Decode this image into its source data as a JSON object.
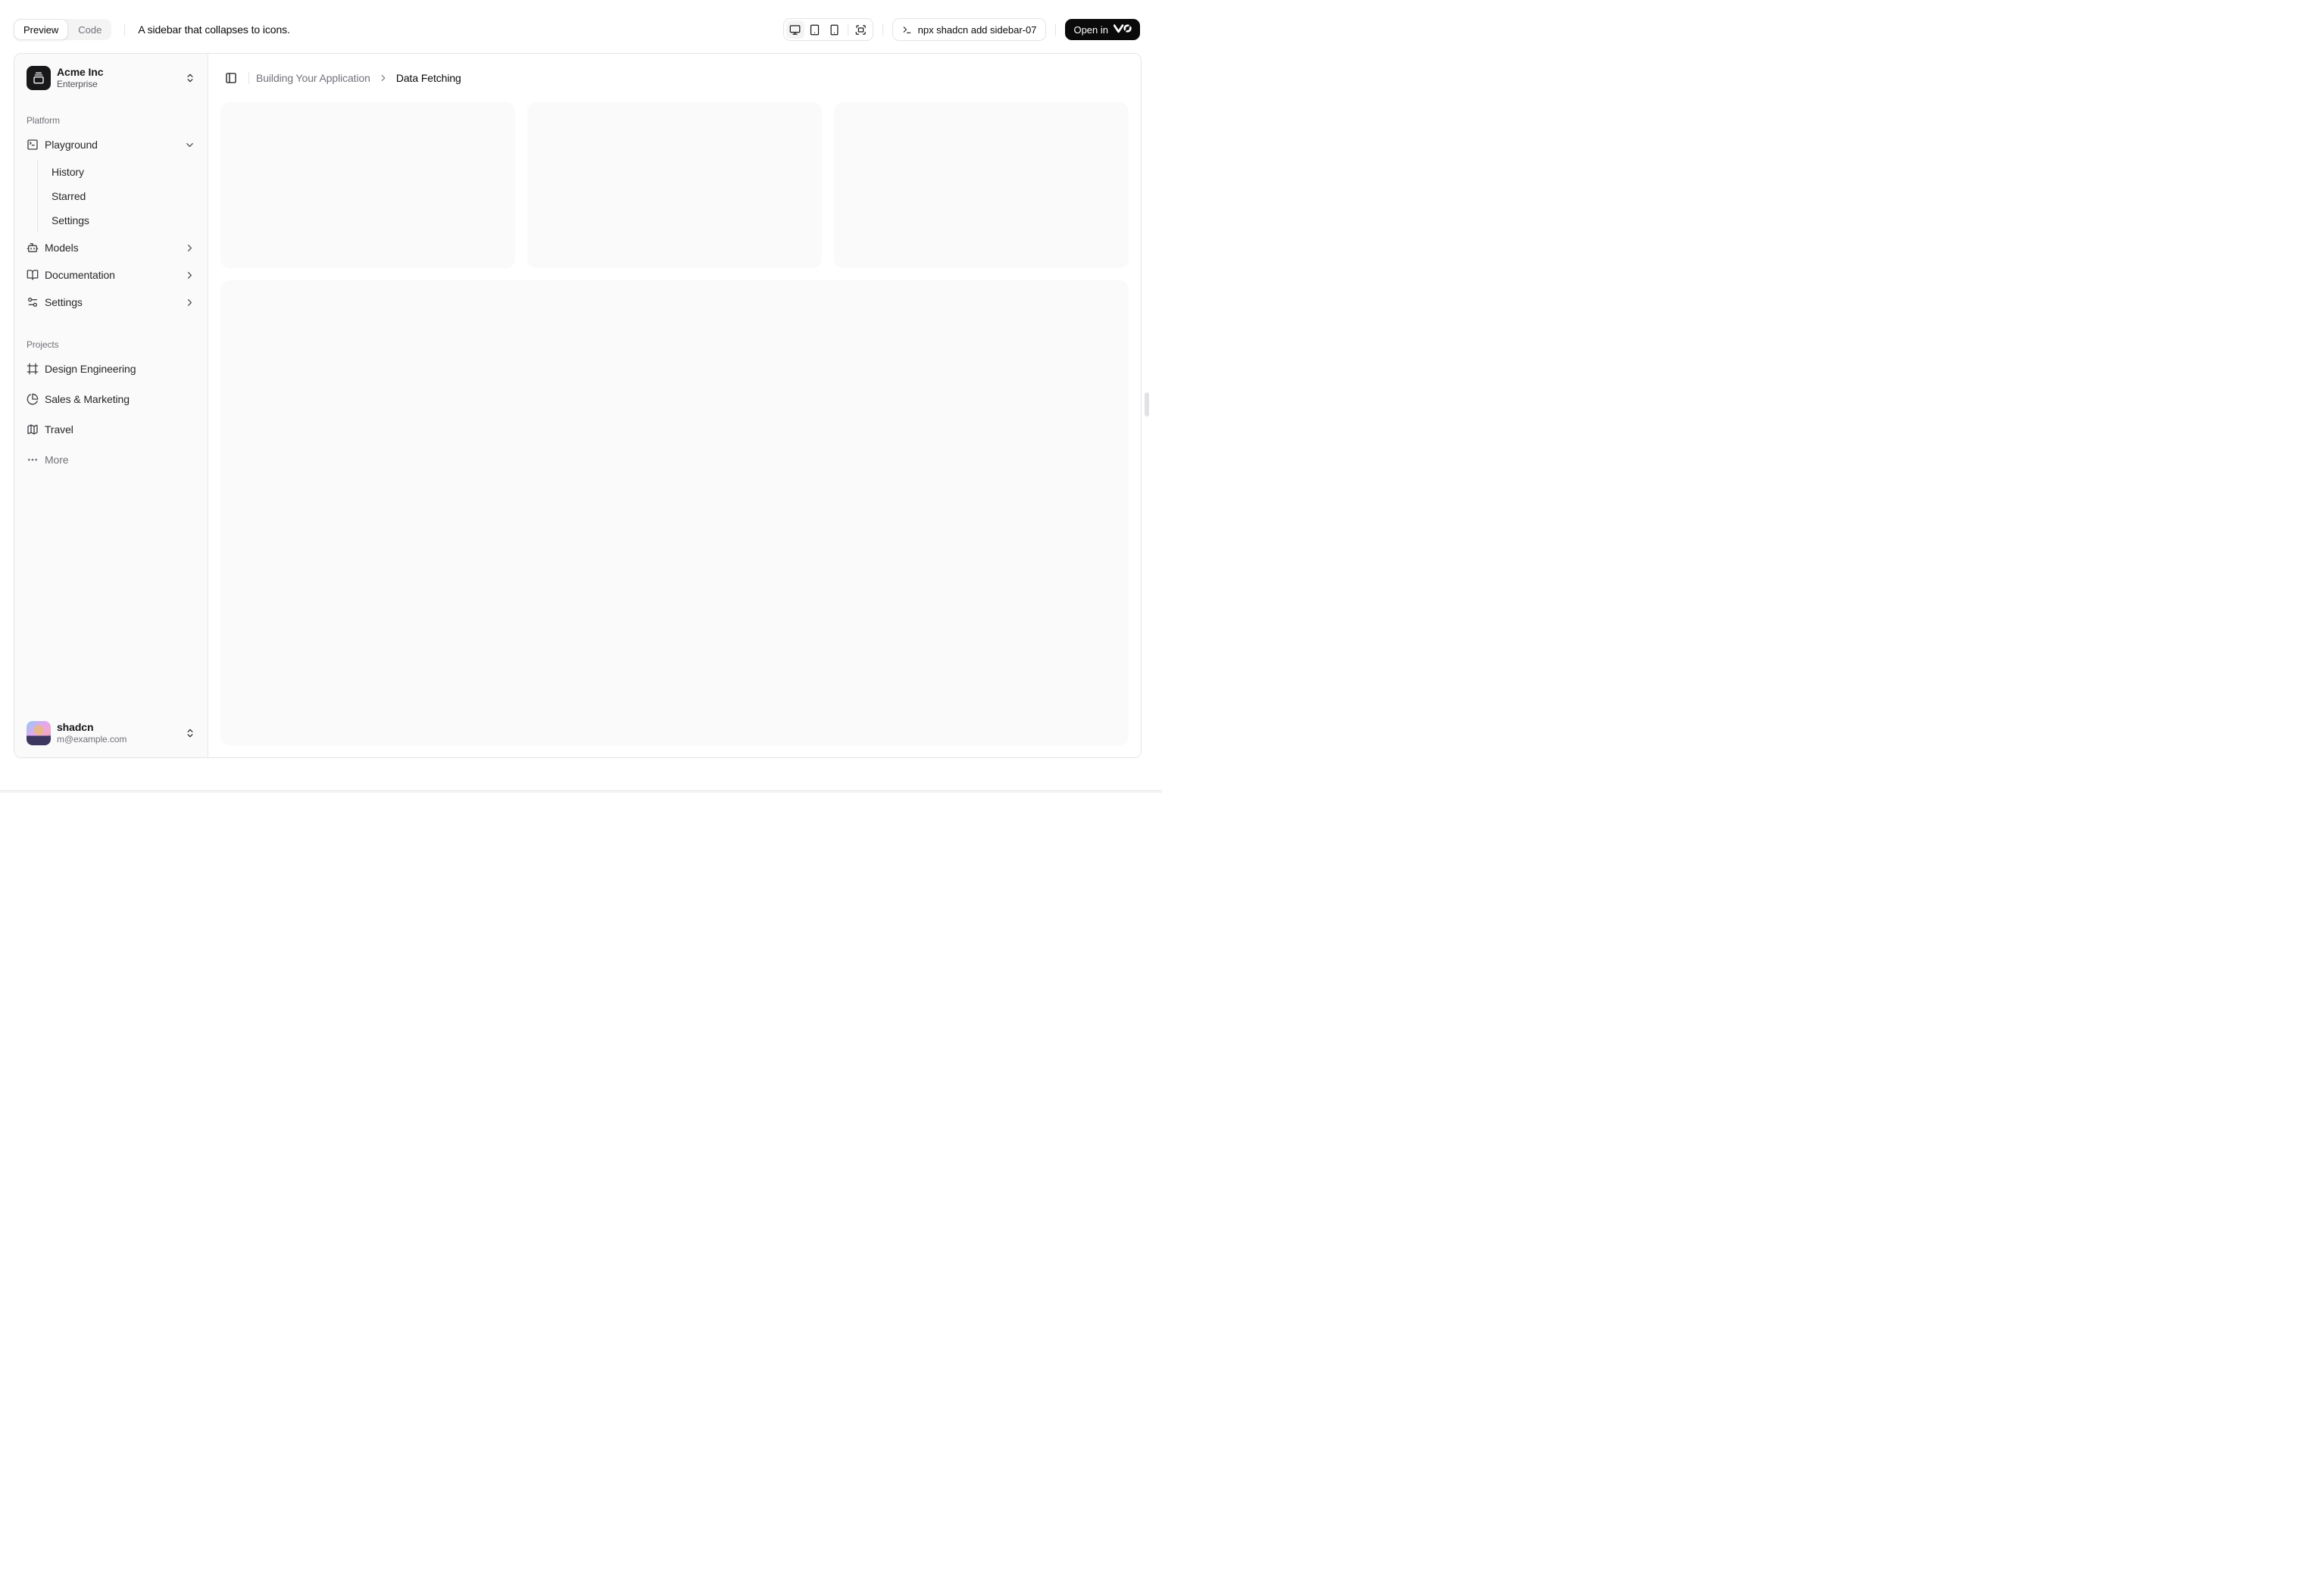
{
  "toolbar": {
    "preview_label": "Preview",
    "code_label": "Code",
    "active_view": "Preview",
    "description": "A sidebar that collapses to icons.",
    "device_icons": [
      "monitor",
      "tablet",
      "smartphone",
      "fullscreen"
    ],
    "active_device": "monitor",
    "command": "npx shadcn add sidebar-07",
    "open_in_label": "Open in",
    "open_in_logo": "v0"
  },
  "sidebar": {
    "team": {
      "name": "Acme Inc",
      "plan": "Enterprise",
      "icon": "gallery-vertical-end"
    },
    "groups": [
      {
        "label": "Platform",
        "items": [
          {
            "label": "Playground",
            "icon": "square-terminal",
            "expanded": true,
            "children": [
              "History",
              "Starred",
              "Settings"
            ]
          },
          {
            "label": "Models",
            "icon": "bot"
          },
          {
            "label": "Documentation",
            "icon": "book-open"
          },
          {
            "label": "Settings",
            "icon": "sliders"
          }
        ]
      },
      {
        "label": "Projects",
        "items": [
          {
            "label": "Design Engineering",
            "icon": "frame"
          },
          {
            "label": "Sales & Marketing",
            "icon": "pie-chart"
          },
          {
            "label": "Travel",
            "icon": "map"
          },
          {
            "label": "More",
            "icon": "ellipsis",
            "muted": true
          }
        ]
      }
    ],
    "user": {
      "name": "shadcn",
      "email": "m@example.com"
    }
  },
  "main": {
    "breadcrumb": {
      "section": "Building Your Application",
      "page": "Data Fetching"
    },
    "placeholders": {
      "top_cards": 3,
      "body_blocks": 1
    }
  },
  "colors": {
    "border": "#e4e4e7",
    "sidebar_background": "#fafafa",
    "placeholder_background": "#fafafa",
    "primary": "#18181b",
    "muted_text": "#71717a",
    "open_in_v0_background": "#0a0a0a"
  }
}
